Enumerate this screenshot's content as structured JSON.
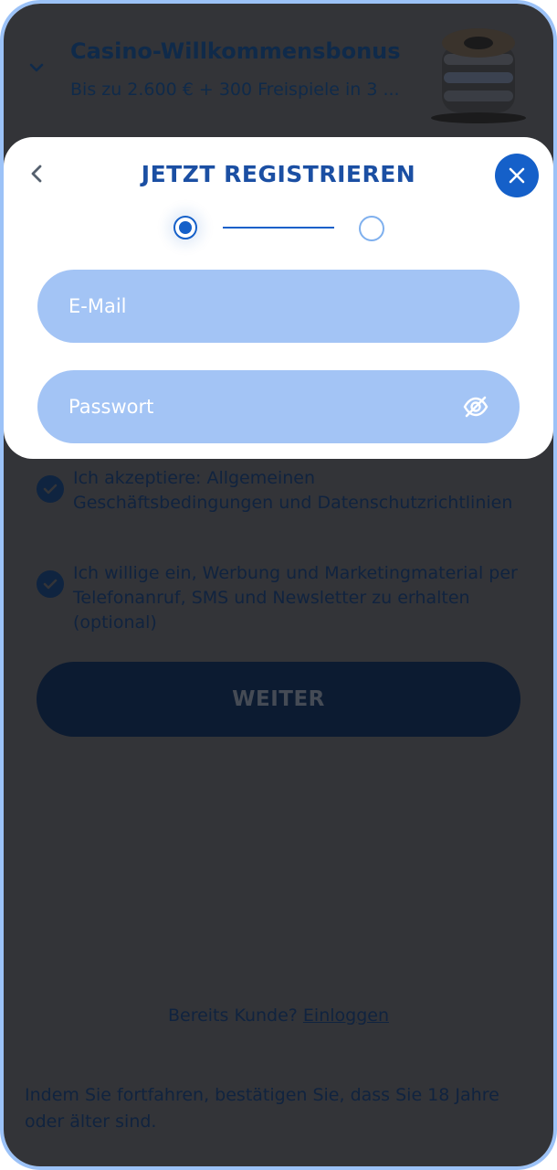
{
  "bonus": {
    "title": "Casino-Willkommensbonus",
    "subtitle": "Bis zu 2.600 € + 300 Freispiele in 3 ..."
  },
  "modal": {
    "title": "JETZT REGISTRIEREN",
    "steps": {
      "current": 1,
      "total": 2
    },
    "email_placeholder": "E-Mail",
    "password_placeholder": "Passwort"
  },
  "consents": [
    {
      "text": "Ich akzeptiere: Allgemeinen Geschäftsbedingungen und Datenschutzrichtlinien",
      "checked": true
    },
    {
      "text": "Ich willige ein, Werbung und Marketingmaterial per Telefonanruf, SMS und Newsletter zu erhalten (optional)",
      "checked": true
    }
  ],
  "continue_label": "WEITER",
  "login": {
    "prompt": "Bereits Kunde?",
    "link": "Einloggen"
  },
  "age_note": "Indem Sie fortfahren, bestätigen Sie, dass Sie 18 Jahre oder älter sind.",
  "colors": {
    "accent": "#1560c9",
    "title": "#1b4fa3",
    "field": "#a3c4f5",
    "overlay": "#333438",
    "frame": "#9cc2f7"
  },
  "icons": [
    "chevron-down-icon",
    "bonus-coins-icon",
    "chevron-left-icon",
    "close-icon",
    "eye-off-icon",
    "check-icon"
  ]
}
